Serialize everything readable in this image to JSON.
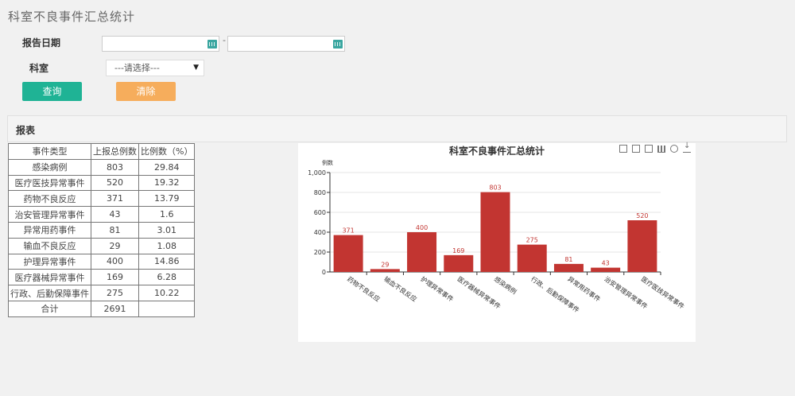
{
  "page": {
    "title": "科室不良事件汇总统计"
  },
  "filters": {
    "report_date_label": "报告日期",
    "date_from": {
      "value": ""
    },
    "date_separator": "-",
    "date_to": {
      "value": ""
    },
    "department_label": "科室",
    "department_select": {
      "selected": "---请选择---"
    }
  },
  "buttons": {
    "query_label": "查询",
    "clear_label": "清除"
  },
  "report": {
    "title": "报表"
  },
  "table": {
    "headers": [
      "事件类型",
      "上报总例数",
      "比例数（%）"
    ],
    "rows": [
      [
        "感染病例",
        "803",
        "29.84"
      ],
      [
        "医疗医技异常事件",
        "520",
        "19.32"
      ],
      [
        "药物不良反应",
        "371",
        "13.79"
      ],
      [
        "治安管理异常事件",
        "43",
        "1.6"
      ],
      [
        "异常用药事件",
        "81",
        "3.01"
      ],
      [
        "输血不良反应",
        "29",
        "1.08"
      ],
      [
        "护理异常事件",
        "400",
        "14.86"
      ],
      [
        "医疗器械异常事件",
        "169",
        "6.28"
      ],
      [
        "行政、后勤保障事件",
        "275",
        "10.22"
      ],
      [
        "合计",
        "2691",
        ""
      ]
    ]
  },
  "toolbar_icons": [
    "zoom-icon",
    "zoom-reset-icon",
    "line-chart-icon",
    "bar-chart-icon",
    "refresh-icon",
    "download-icon"
  ],
  "colors": {
    "bar": "#c23531",
    "query_button": "#1fb395",
    "clear_button": "#f6ad5c"
  },
  "chart_data": {
    "type": "bar",
    "title": "科室不良事件汇总统计",
    "ylabel": "例数",
    "xlabel": "",
    "categories": [
      "药物不良反应",
      "输血不良反应",
      "护理异常事件",
      "医疗器械异常事件",
      "感染病例",
      "行政、后勤保障事件",
      "异常用药事件",
      "治安管理异常事件",
      "医疗医技异常事件"
    ],
    "values": [
      371,
      29,
      400,
      169,
      803,
      275,
      81,
      43,
      520
    ],
    "yticks": [
      "0",
      "200",
      "400",
      "600",
      "800",
      "1,000"
    ],
    "ylim": [
      0,
      1000
    ],
    "grid": true
  }
}
